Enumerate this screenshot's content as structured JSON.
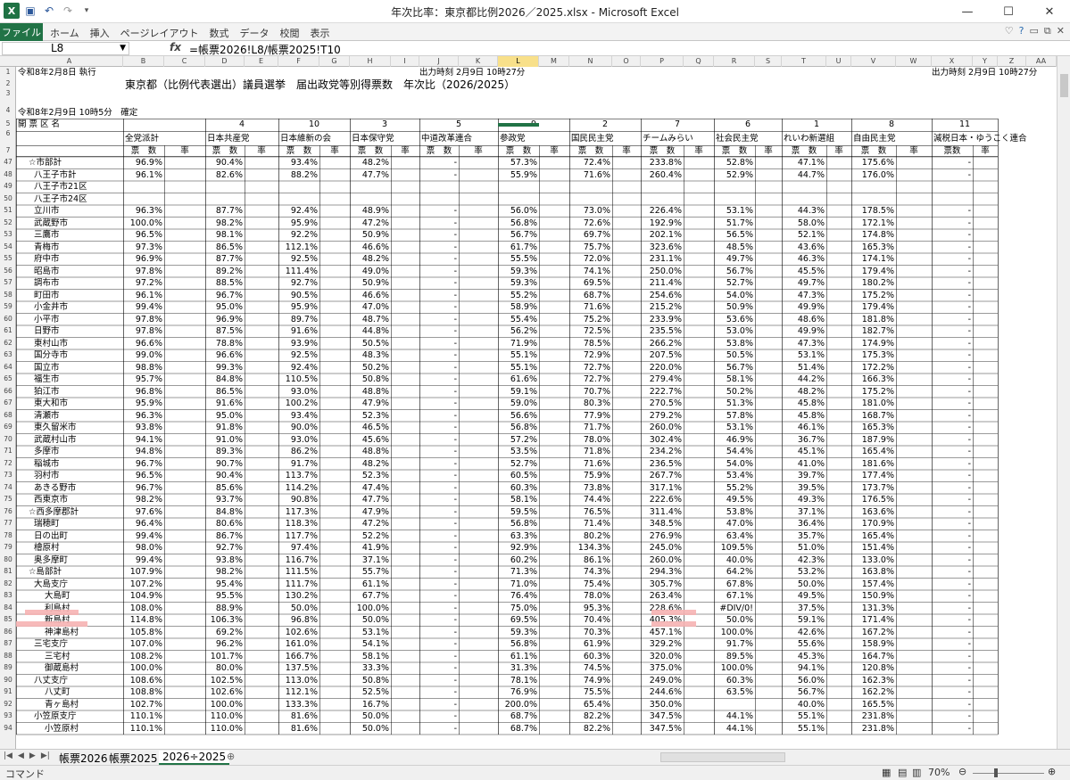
{
  "window": {
    "title": "年次比率：東京都比例2026／2025.xlsx - Microsoft Excel"
  },
  "ribbon": {
    "file_label": "ファイル",
    "tabs": [
      "ホーム",
      "挿入",
      "ページレイアウト",
      "数式",
      "データ",
      "校閲",
      "表示"
    ]
  },
  "formula_bar": {
    "name_box": "L8",
    "fx": "fx",
    "formula": "=帳票2026!L8/帳票2025!T10"
  },
  "columns": [
    "A",
    "B",
    "C",
    "D",
    "E",
    "F",
    "G",
    "H",
    "I",
    "J",
    "K",
    "L",
    "M",
    "N",
    "O",
    "P",
    "Q",
    "R",
    "S",
    "T",
    "U",
    "V",
    "W",
    "X",
    "Y",
    "Z",
    "AA"
  ],
  "selected_column": "L",
  "header": {
    "exec_date": "令和8年2月8日 執行",
    "output_time_1": "出力時刻 2月9日 10時27分",
    "output_time_2": "出力時刻 2月9日 10時27分",
    "title": "東京都（比例代表選出）議員選挙　届出政党等別得票数　年次比（2026/2025）",
    "confirmed": "令和8年2月9日 10時5分　確定",
    "district_label": "開 票 区 名",
    "total_label": "全党派計",
    "votes_label": "票　数",
    "rate_label": "率",
    "votes_label_short": "票数"
  },
  "parties": [
    {
      "num": "4",
      "name": "日本共産党"
    },
    {
      "num": "10",
      "name": "日本維新の会"
    },
    {
      "num": "3",
      "name": "日本保守党"
    },
    {
      "num": "5",
      "name": "中道改革連合"
    },
    {
      "num": "9",
      "name": "参政党"
    },
    {
      "num": "2",
      "name": "国民民主党"
    },
    {
      "num": "7",
      "name": "チームみらい"
    },
    {
      "num": "6",
      "name": "社会民主党"
    },
    {
      "num": "1",
      "name": "れいわ新選組"
    },
    {
      "num": "8",
      "name": "自由民主党"
    },
    {
      "num": "11",
      "name": "減税日本・ゆうこく連合"
    }
  ],
  "row_numbers": [
    "1",
    "2",
    "3",
    "4",
    "5",
    "6",
    "7",
    "47",
    "48",
    "49",
    "50",
    "51",
    "52",
    "53",
    "54",
    "55",
    "56",
    "57",
    "58",
    "59",
    "60",
    "61",
    "62",
    "63",
    "64",
    "65",
    "66",
    "67",
    "68",
    "69",
    "70",
    "71",
    "72",
    "73",
    "74",
    "75",
    "76",
    "77",
    "78",
    "79",
    "80",
    "81",
    "82",
    "83",
    "84",
    "85",
    "86",
    "87",
    "88",
    "89",
    "90",
    "91",
    "92",
    "93",
    "94"
  ],
  "rows": [
    {
      "name": "☆市部計",
      "indent": 0,
      "v": [
        "96.9%",
        "90.4%",
        "93.4%",
        "48.2%",
        "-",
        "57.3%",
        "72.4%",
        "233.8%",
        "52.8%",
        "47.1%",
        "175.6%",
        "-"
      ]
    },
    {
      "name": "八王子市計",
      "indent": 1,
      "v": [
        "96.1%",
        "82.6%",
        "88.2%",
        "47.7%",
        "-",
        "55.9%",
        "71.6%",
        "260.4%",
        "52.9%",
        "44.7%",
        "176.0%",
        "-"
      ]
    },
    {
      "name": "八王子市21区",
      "indent": 1,
      "v": [
        "",
        "",
        "",
        "",
        "",
        "",
        "",
        "",
        "",
        "",
        "",
        ""
      ]
    },
    {
      "name": "八王子市24区",
      "indent": 1,
      "v": [
        "",
        "",
        "",
        "",
        "",
        "",
        "",
        "",
        "",
        "",
        "",
        ""
      ]
    },
    {
      "name": "立川市",
      "indent": 1,
      "v": [
        "96.3%",
        "87.7%",
        "92.4%",
        "48.9%",
        "-",
        "56.0%",
        "73.0%",
        "226.4%",
        "53.1%",
        "44.3%",
        "178.5%",
        "-"
      ]
    },
    {
      "name": "武蔵野市",
      "indent": 1,
      "v": [
        "100.0%",
        "98.2%",
        "95.9%",
        "47.2%",
        "-",
        "56.8%",
        "72.6%",
        "192.9%",
        "51.7%",
        "58.0%",
        "172.1%",
        "-"
      ]
    },
    {
      "name": "三鷹市",
      "indent": 1,
      "v": [
        "96.5%",
        "98.1%",
        "92.2%",
        "50.9%",
        "-",
        "56.7%",
        "69.7%",
        "202.1%",
        "56.5%",
        "52.1%",
        "174.8%",
        "-"
      ]
    },
    {
      "name": "青梅市",
      "indent": 1,
      "v": [
        "97.3%",
        "86.5%",
        "112.1%",
        "46.6%",
        "-",
        "61.7%",
        "75.7%",
        "323.6%",
        "48.5%",
        "43.6%",
        "165.3%",
        "-"
      ]
    },
    {
      "name": "府中市",
      "indent": 1,
      "v": [
        "96.9%",
        "87.7%",
        "92.5%",
        "48.2%",
        "-",
        "55.5%",
        "72.0%",
        "231.1%",
        "49.7%",
        "46.3%",
        "174.1%",
        "-"
      ]
    },
    {
      "name": "昭島市",
      "indent": 1,
      "v": [
        "97.8%",
        "89.2%",
        "111.4%",
        "49.0%",
        "-",
        "59.3%",
        "74.1%",
        "250.0%",
        "56.7%",
        "45.5%",
        "179.4%",
        "-"
      ]
    },
    {
      "name": "調布市",
      "indent": 1,
      "v": [
        "97.2%",
        "88.5%",
        "92.7%",
        "50.9%",
        "-",
        "59.3%",
        "69.5%",
        "211.4%",
        "52.7%",
        "49.7%",
        "180.2%",
        "-"
      ]
    },
    {
      "name": "町田市",
      "indent": 1,
      "v": [
        "96.1%",
        "96.7%",
        "90.5%",
        "46.6%",
        "-",
        "55.2%",
        "68.7%",
        "254.6%",
        "54.0%",
        "47.3%",
        "175.2%",
        "-"
      ]
    },
    {
      "name": "小金井市",
      "indent": 1,
      "v": [
        "99.4%",
        "95.0%",
        "95.9%",
        "47.0%",
        "-",
        "58.9%",
        "71.6%",
        "215.2%",
        "50.9%",
        "49.9%",
        "179.4%",
        "-"
      ]
    },
    {
      "name": "小平市",
      "indent": 1,
      "v": [
        "97.8%",
        "96.9%",
        "89.7%",
        "48.7%",
        "-",
        "55.4%",
        "75.2%",
        "233.9%",
        "53.6%",
        "48.6%",
        "181.8%",
        "-"
      ]
    },
    {
      "name": "日野市",
      "indent": 1,
      "v": [
        "97.8%",
        "87.5%",
        "91.6%",
        "44.8%",
        "-",
        "56.2%",
        "72.5%",
        "235.5%",
        "53.0%",
        "49.9%",
        "182.7%",
        "-"
      ]
    },
    {
      "name": "東村山市",
      "indent": 1,
      "v": [
        "96.6%",
        "78.8%",
        "93.9%",
        "50.5%",
        "-",
        "71.9%",
        "78.5%",
        "266.2%",
        "53.8%",
        "47.3%",
        "174.9%",
        "-"
      ]
    },
    {
      "name": "国分寺市",
      "indent": 1,
      "v": [
        "99.0%",
        "96.6%",
        "92.5%",
        "48.3%",
        "-",
        "55.1%",
        "72.9%",
        "207.5%",
        "50.5%",
        "53.1%",
        "175.3%",
        "-"
      ]
    },
    {
      "name": "国立市",
      "indent": 1,
      "v": [
        "98.8%",
        "99.3%",
        "92.4%",
        "50.2%",
        "-",
        "55.1%",
        "72.7%",
        "220.0%",
        "56.7%",
        "51.4%",
        "172.2%",
        "-"
      ]
    },
    {
      "name": "福生市",
      "indent": 1,
      "v": [
        "95.7%",
        "84.8%",
        "110.5%",
        "50.8%",
        "-",
        "61.6%",
        "72.7%",
        "279.4%",
        "58.1%",
        "44.2%",
        "166.3%",
        "-"
      ]
    },
    {
      "name": "狛江市",
      "indent": 1,
      "v": [
        "96.8%",
        "86.5%",
        "93.0%",
        "48.8%",
        "-",
        "59.1%",
        "70.7%",
        "222.7%",
        "50.2%",
        "48.2%",
        "175.2%",
        "-"
      ]
    },
    {
      "name": "東大和市",
      "indent": 1,
      "v": [
        "95.9%",
        "91.6%",
        "100.2%",
        "47.9%",
        "-",
        "59.0%",
        "80.3%",
        "270.5%",
        "51.3%",
        "45.8%",
        "181.0%",
        "-"
      ]
    },
    {
      "name": "清瀬市",
      "indent": 1,
      "v": [
        "96.3%",
        "95.0%",
        "93.4%",
        "52.3%",
        "-",
        "56.6%",
        "77.9%",
        "279.2%",
        "57.8%",
        "45.8%",
        "168.7%",
        "-"
      ]
    },
    {
      "name": "東久留米市",
      "indent": 1,
      "v": [
        "93.8%",
        "91.8%",
        "90.0%",
        "46.5%",
        "-",
        "56.8%",
        "71.7%",
        "260.0%",
        "53.1%",
        "46.1%",
        "165.3%",
        "-"
      ]
    },
    {
      "name": "武蔵村山市",
      "indent": 1,
      "v": [
        "94.1%",
        "91.0%",
        "93.0%",
        "45.6%",
        "-",
        "57.2%",
        "78.0%",
        "302.4%",
        "46.9%",
        "36.7%",
        "187.9%",
        "-"
      ]
    },
    {
      "name": "多摩市",
      "indent": 1,
      "v": [
        "94.8%",
        "89.3%",
        "86.2%",
        "48.8%",
        "-",
        "53.5%",
        "71.8%",
        "234.2%",
        "54.4%",
        "45.1%",
        "165.4%",
        "-"
      ]
    },
    {
      "name": "稲城市",
      "indent": 1,
      "v": [
        "96.7%",
        "90.7%",
        "91.7%",
        "48.2%",
        "-",
        "52.7%",
        "71.6%",
        "236.5%",
        "54.0%",
        "41.0%",
        "181.6%",
        "-"
      ]
    },
    {
      "name": "羽村市",
      "indent": 1,
      "v": [
        "96.5%",
        "90.4%",
        "113.7%",
        "52.3%",
        "-",
        "60.5%",
        "75.9%",
        "267.7%",
        "53.4%",
        "39.7%",
        "177.4%",
        "-"
      ]
    },
    {
      "name": "あきる野市",
      "indent": 1,
      "v": [
        "96.7%",
        "85.6%",
        "114.2%",
        "47.4%",
        "-",
        "60.3%",
        "73.8%",
        "317.1%",
        "55.2%",
        "39.5%",
        "173.7%",
        "-"
      ]
    },
    {
      "name": "西東京市",
      "indent": 1,
      "v": [
        "98.2%",
        "93.7%",
        "90.8%",
        "47.7%",
        "-",
        "58.1%",
        "74.4%",
        "222.6%",
        "49.5%",
        "49.3%",
        "176.5%",
        "-"
      ]
    },
    {
      "name": "☆西多摩郡計",
      "indent": 0,
      "v": [
        "97.6%",
        "84.8%",
        "117.3%",
        "47.9%",
        "-",
        "59.5%",
        "76.5%",
        "311.4%",
        "53.8%",
        "37.1%",
        "163.6%",
        "-"
      ]
    },
    {
      "name": "瑞穂町",
      "indent": 1,
      "v": [
        "96.4%",
        "80.6%",
        "118.3%",
        "47.2%",
        "-",
        "56.8%",
        "71.4%",
        "348.5%",
        "47.0%",
        "36.4%",
        "170.9%",
        "-"
      ]
    },
    {
      "name": "日の出町",
      "indent": 1,
      "v": [
        "99.4%",
        "86.7%",
        "117.7%",
        "52.2%",
        "-",
        "63.3%",
        "80.2%",
        "276.9%",
        "63.4%",
        "35.7%",
        "165.4%",
        "-"
      ]
    },
    {
      "name": "檜原村",
      "indent": 1,
      "v": [
        "98.0%",
        "92.7%",
        "97.4%",
        "41.9%",
        "-",
        "92.9%",
        "134.3%",
        "245.0%",
        "109.5%",
        "51.0%",
        "151.4%",
        "-"
      ]
    },
    {
      "name": "奥多摩町",
      "indent": 1,
      "v": [
        "99.4%",
        "93.8%",
        "116.7%",
        "37.1%",
        "-",
        "60.2%",
        "86.1%",
        "260.0%",
        "40.0%",
        "42.3%",
        "133.0%",
        "-"
      ]
    },
    {
      "name": "☆島部計",
      "indent": 0,
      "v": [
        "107.9%",
        "98.2%",
        "111.5%",
        "55.7%",
        "-",
        "71.3%",
        "74.3%",
        "294.3%",
        "64.2%",
        "53.2%",
        "163.8%",
        "-"
      ]
    },
    {
      "name": "大島支庁",
      "indent": 1,
      "v": [
        "107.2%",
        "95.4%",
        "111.7%",
        "61.1%",
        "-",
        "71.0%",
        "75.4%",
        "305.7%",
        "67.8%",
        "50.0%",
        "157.4%",
        "-"
      ]
    },
    {
      "name": "大島町",
      "indent": 2,
      "v": [
        "104.9%",
        "95.5%",
        "130.2%",
        "67.7%",
        "-",
        "76.4%",
        "78.0%",
        "263.4%",
        "67.1%",
        "49.5%",
        "150.9%",
        "-"
      ]
    },
    {
      "name": "利島村",
      "indent": 2,
      "v": [
        "108.0%",
        "88.9%",
        "50.0%",
        "100.0%",
        "-",
        "75.0%",
        "95.3%",
        "228.6%",
        "#DIV/0!",
        "37.5%",
        "131.3%",
        "-"
      ]
    },
    {
      "name": "新島村",
      "indent": 2,
      "v": [
        "114.8%",
        "106.3%",
        "96.8%",
        "50.0%",
        "-",
        "69.5%",
        "70.4%",
        "405.3%",
        "50.0%",
        "59.1%",
        "171.4%",
        "-"
      ]
    },
    {
      "name": "神津島村",
      "indent": 2,
      "v": [
        "105.8%",
        "69.2%",
        "102.6%",
        "53.1%",
        "-",
        "59.3%",
        "70.3%",
        "457.1%",
        "100.0%",
        "42.6%",
        "167.2%",
        "-"
      ]
    },
    {
      "name": "三宅支庁",
      "indent": 1,
      "v": [
        "107.0%",
        "96.2%",
        "161.0%",
        "54.1%",
        "-",
        "56.8%",
        "61.9%",
        "329.2%",
        "91.7%",
        "55.6%",
        "158.9%",
        "-"
      ]
    },
    {
      "name": "三宅村",
      "indent": 2,
      "v": [
        "108.2%",
        "101.7%",
        "166.7%",
        "58.1%",
        "-",
        "61.1%",
        "60.3%",
        "320.0%",
        "89.5%",
        "45.3%",
        "164.7%",
        "-"
      ]
    },
    {
      "name": "御蔵島村",
      "indent": 2,
      "v": [
        "100.0%",
        "80.0%",
        "137.5%",
        "33.3%",
        "-",
        "31.3%",
        "74.5%",
        "375.0%",
        "100.0%",
        "94.1%",
        "120.8%",
        "-"
      ]
    },
    {
      "name": "八丈支庁",
      "indent": 1,
      "v": [
        "108.6%",
        "102.5%",
        "113.0%",
        "50.8%",
        "-",
        "78.1%",
        "74.9%",
        "249.0%",
        "60.3%",
        "56.0%",
        "162.3%",
        "-"
      ]
    },
    {
      "name": "八丈町",
      "indent": 2,
      "v": [
        "108.8%",
        "102.6%",
        "112.1%",
        "52.5%",
        "-",
        "76.9%",
        "75.5%",
        "244.6%",
        "63.5%",
        "56.7%",
        "162.2%",
        "-"
      ]
    },
    {
      "name": "青ヶ島村",
      "indent": 2,
      "v": [
        "102.7%",
        "100.0%",
        "133.3%",
        "16.7%",
        "-",
        "200.0%",
        "65.4%",
        "350.0%",
        "",
        "40.0%",
        "165.5%",
        "-"
      ]
    },
    {
      "name": "小笠原支庁",
      "indent": 1,
      "v": [
        "110.1%",
        "110.0%",
        "81.6%",
        "50.0%",
        "-",
        "68.7%",
        "82.2%",
        "347.5%",
        "44.1%",
        "55.1%",
        "231.8%",
        "-"
      ]
    },
    {
      "name": "小笠原村",
      "indent": 2,
      "v": [
        "110.1%",
        "110.0%",
        "81.6%",
        "50.0%",
        "-",
        "68.7%",
        "82.2%",
        "347.5%",
        "44.1%",
        "55.1%",
        "231.8%",
        "-"
      ]
    }
  ],
  "sheet_tabs": [
    "帳票2026",
    "帳票2025",
    "2026÷2025"
  ],
  "status": {
    "mode": "コマンド",
    "zoom": "70%"
  }
}
